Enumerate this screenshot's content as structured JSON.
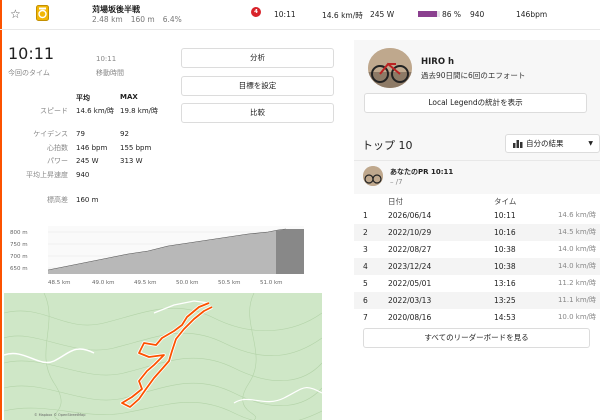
{
  "header": {
    "segment_name": "苅場坂後半戦",
    "distance": "2.48 km",
    "elevation": "160 m",
    "grade": "6.4%",
    "rank_badge": "4",
    "time": "10:11",
    "speed": "14.6 km/時",
    "power": "245 W",
    "heart_rate_percent": "86 %",
    "heart_rate_fraction": 0.86,
    "cadence_value": "940",
    "heart_rate": "146bpm",
    "accent_color": "#fc5200"
  },
  "summary": {
    "elapsed_time": "10:11",
    "elapsed_label": "今回のタイム",
    "moving_time": "10:11",
    "moving_label": "移動時間"
  },
  "actions": {
    "analyze": "分析",
    "set_goal": "目標を設定",
    "compare": "比較"
  },
  "stats": {
    "avg_header": "平均",
    "max_header": "MAX",
    "rows": [
      {
        "label": "スピード",
        "avg": "14.6 km/時",
        "max": "19.8 km/時"
      },
      {
        "label": "ケイデンス",
        "avg": "79",
        "max": "92"
      },
      {
        "label": "心拍数",
        "avg": "146 bpm",
        "max": "155 bpm"
      },
      {
        "label": "パワー",
        "avg": "245 W",
        "max": "313 W"
      },
      {
        "label": "平均上昇速度",
        "avg": "940",
        "max": ""
      },
      {
        "label": "標高差",
        "avg": "160 m",
        "max": ""
      }
    ]
  },
  "elevation_chart": {
    "y_ticks": [
      "800 m",
      "750 m",
      "700 m",
      "650 m"
    ],
    "x_ticks": [
      "48.5 km",
      "49.0 km",
      "49.5 km",
      "50.0 km",
      "50.5 km",
      "51.0 km"
    ]
  },
  "map": {
    "attribution": "© Mapbox © OpenStreetMap"
  },
  "profile": {
    "name": "HIRO h",
    "efforts": "過去90日間に6回のエフォート",
    "local_legend_button": "Local Legendの統計を表示"
  },
  "top10": {
    "title": "トップ 10",
    "filter": "自分の結果",
    "pr_title": "あなたのPR 10:11",
    "pr_rank": "– /7",
    "col_date": "日付",
    "col_time": "タイム",
    "rows": [
      {
        "rank": "1",
        "date": "2026/06/14",
        "time": "10:11",
        "speed": "14.6 km/時"
      },
      {
        "rank": "2",
        "date": "2022/10/29",
        "time": "10:16",
        "speed": "14.5 km/時"
      },
      {
        "rank": "3",
        "date": "2022/08/27",
        "time": "10:38",
        "speed": "14.0 km/時"
      },
      {
        "rank": "4",
        "date": "2023/12/24",
        "time": "10:38",
        "speed": "14.0 km/時"
      },
      {
        "rank": "5",
        "date": "2022/05/01",
        "time": "13:16",
        "speed": "11.2 km/時"
      },
      {
        "rank": "6",
        "date": "2022/03/13",
        "time": "13:25",
        "speed": "11.1 km/時"
      },
      {
        "rank": "7",
        "date": "2020/08/16",
        "time": "14:53",
        "speed": "10.0 km/時"
      }
    ],
    "all_button": "すべてのリーダーボードを見る"
  }
}
